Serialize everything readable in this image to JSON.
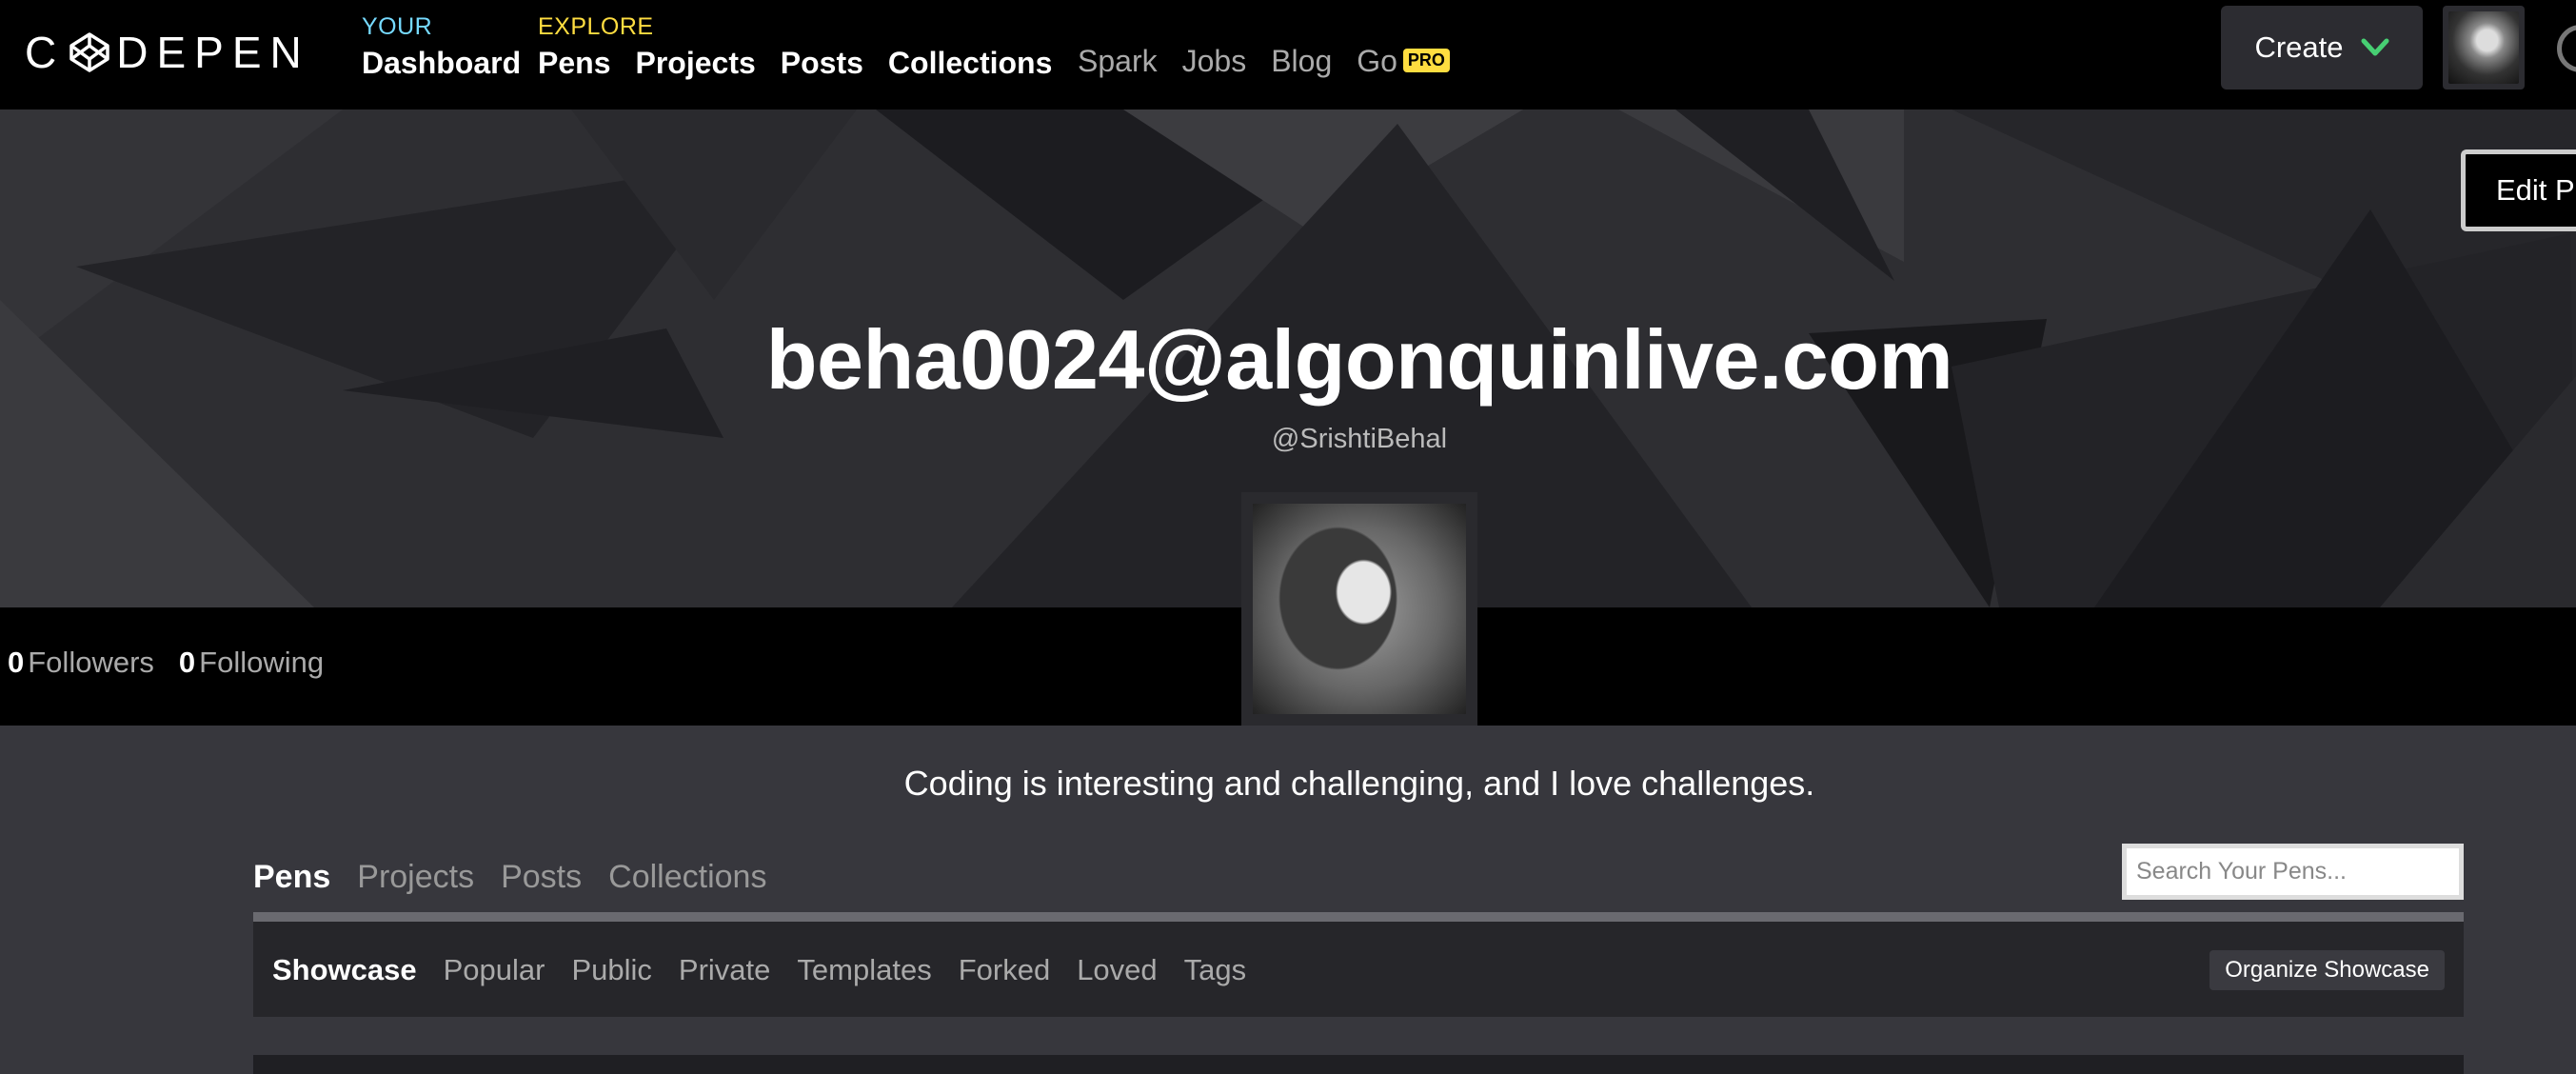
{
  "brand": {
    "logo_text": "CODEPEN",
    "logo_icon": "codepen-cube-icon"
  },
  "nav": {
    "your": {
      "kicker": "YOUR",
      "kicker_color": "#76daff",
      "links": [
        "Dashboard"
      ]
    },
    "explore": {
      "kicker": "EXPLORE",
      "kicker_color": "#ffdd40",
      "links": [
        "Pens",
        "Projects",
        "Posts",
        "Collections"
      ]
    },
    "secondary": [
      "Spark",
      "Jobs",
      "Blog",
      "Go"
    ],
    "pro_badge": "PRO",
    "create_label": "Create",
    "create_icon": "chevron-down-icon",
    "create_icon_color": "#47cf73"
  },
  "profile": {
    "edit_label": "Edit Pr",
    "name": "beha0024@algonquinlive.com",
    "handle": "@SrishtiBehal",
    "followers_count": "0",
    "followers_label": "Followers",
    "following_count": "0",
    "following_label": "Following",
    "bio": "Coding is interesting and challenging, and I love challenges."
  },
  "content": {
    "tabs": [
      {
        "label": "Pens",
        "active": true
      },
      {
        "label": "Projects",
        "active": false
      },
      {
        "label": "Posts",
        "active": false
      },
      {
        "label": "Collections",
        "active": false
      }
    ],
    "search_placeholder": "Search Your Pens...",
    "filters": [
      {
        "label": "Showcase",
        "active": true
      },
      {
        "label": "Popular",
        "active": false
      },
      {
        "label": "Public",
        "active": false
      },
      {
        "label": "Private",
        "active": false
      },
      {
        "label": "Templates",
        "active": false
      },
      {
        "label": "Forked",
        "active": false
      },
      {
        "label": "Loved",
        "active": false
      },
      {
        "label": "Tags",
        "active": false
      }
    ],
    "organize_label": "Organize Showcase"
  }
}
